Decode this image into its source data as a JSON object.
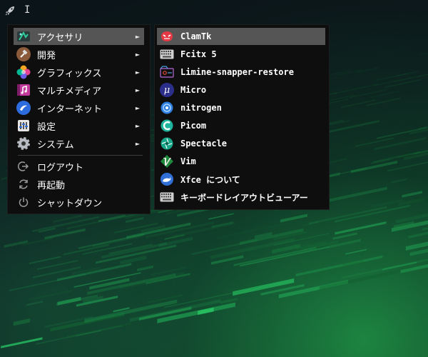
{
  "panel": {
    "launcher_icon": "rocket-icon",
    "cursor_glyph": "I"
  },
  "main_menu": {
    "items": [
      {
        "label": "アクセサリ",
        "icon": "accessories-icon"
      },
      {
        "label": "開発",
        "icon": "hammer-icon"
      },
      {
        "label": "グラフィックス",
        "icon": "graphics-icon"
      },
      {
        "label": "マルチメディア",
        "icon": "multimedia-icon"
      },
      {
        "label": "インターネット",
        "icon": "internet-icon"
      },
      {
        "label": "設定",
        "icon": "settings-icon"
      },
      {
        "label": "システム",
        "icon": "gear-icon"
      }
    ],
    "actions": [
      {
        "label": "ログアウト",
        "icon": "logout-icon"
      },
      {
        "label": "再起動",
        "icon": "restart-icon"
      },
      {
        "label": "シャットダウン",
        "icon": "power-icon"
      }
    ],
    "arrow_glyph": "►"
  },
  "sub_menu": {
    "items": [
      {
        "label": "ClamTk",
        "icon": "clamtk-icon"
      },
      {
        "label": "Fcitx 5",
        "icon": "keyboard-icon"
      },
      {
        "label": "Limine-snapper-restore",
        "icon": "limine-icon"
      },
      {
        "label": "Micro",
        "icon": "micro-icon"
      },
      {
        "label": "nitrogen",
        "icon": "nitrogen-icon"
      },
      {
        "label": "Picom",
        "icon": "picom-icon"
      },
      {
        "label": "Spectacle",
        "icon": "spectacle-icon"
      },
      {
        "label": "Vim",
        "icon": "vim-icon"
      },
      {
        "label": "Xfce について",
        "icon": "xfce-icon"
      },
      {
        "label": "キーボードレイアウトビューアー",
        "icon": "keyboard-icon"
      }
    ],
    "micro_glyph": "μ"
  },
  "colors": {
    "selected": "#555555",
    "menu_bg": "#0e0e0e",
    "accent_green": "#2ecc71"
  }
}
